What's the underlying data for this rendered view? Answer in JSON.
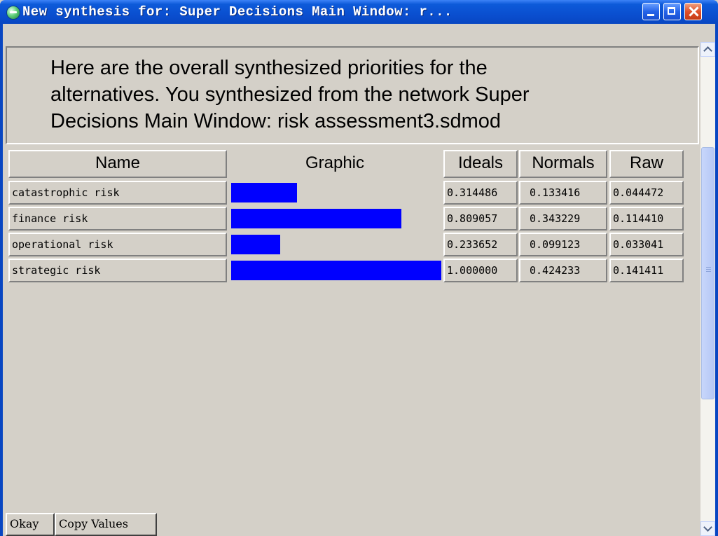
{
  "window": {
    "title": "New synthesis for: Super Decisions Main Window: r...",
    "app_icon": "super-decisions-app-icon",
    "buttons": {
      "minimize": "minimize-icon",
      "maximize": "maximize-icon",
      "close": "close-icon"
    }
  },
  "heading": {
    "lines": [
      "Here are the overall synthesized priorities for the",
      "alternatives.  You synthesized from the network Super",
      "Decisions Main Window: risk assessment3.sdmod"
    ]
  },
  "table": {
    "columns": {
      "name": "Name",
      "graphic": "Graphic",
      "ideals": "Ideals",
      "normals": "Normals",
      "raw": "Raw"
    },
    "bar_color": "#0000ff",
    "rows": [
      {
        "name": "catastrophic risk",
        "ideal_value": 0.314486,
        "ideals": "0.314486",
        "normals": "0.133416",
        "raw": "0.044472"
      },
      {
        "name": "finance risk",
        "ideal_value": 0.809057,
        "ideals": "0.809057",
        "normals": "0.343229",
        "raw": "0.114410"
      },
      {
        "name": "operational risk",
        "ideal_value": 0.233652,
        "ideals": "0.233652",
        "normals": "0.099123",
        "raw": "0.033041"
      },
      {
        "name": "strategic risk",
        "ideal_value": 1.0,
        "ideals": "1.000000",
        "normals": "0.424233",
        "raw": "0.141411"
      }
    ]
  },
  "buttons": {
    "okay": "Okay",
    "copy_values": "Copy Values"
  }
}
